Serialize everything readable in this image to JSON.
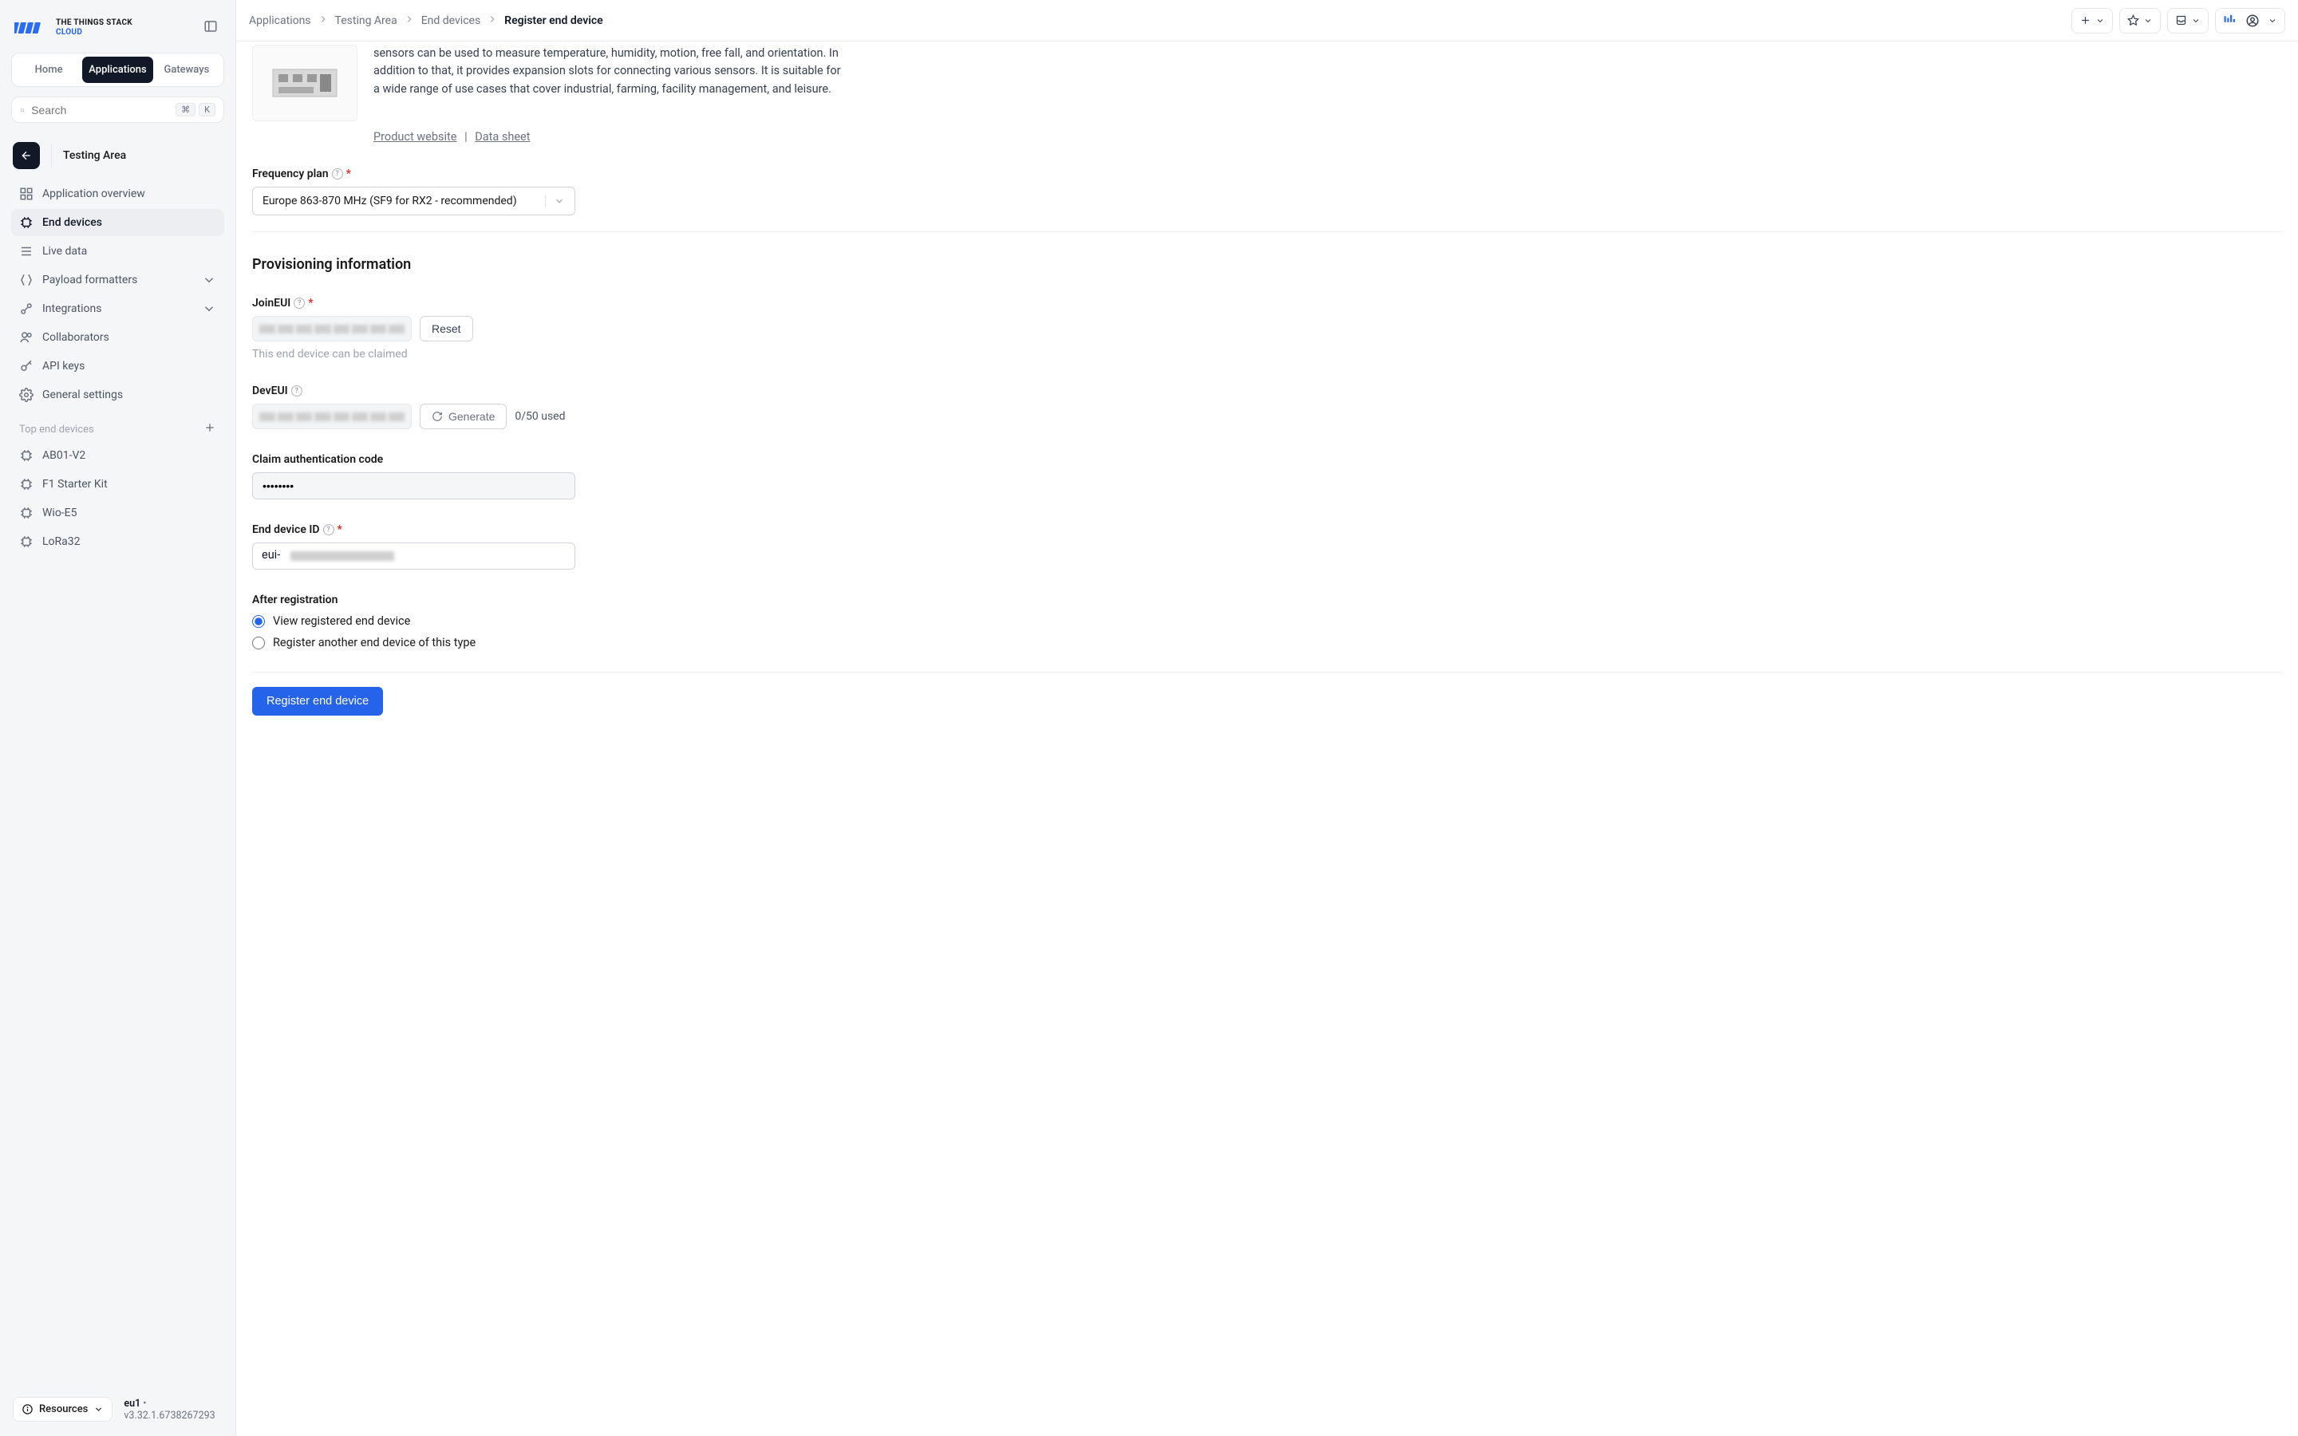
{
  "brand": {
    "line1": "THE THINGS STACK",
    "line2": "CLOUD"
  },
  "tabs": {
    "home": "Home",
    "applications": "Applications",
    "gateways": "Gateways"
  },
  "search": {
    "placeholder": "Search",
    "kbd1": "⌘",
    "kbd2": "K"
  },
  "appContext": {
    "name": "Testing Area"
  },
  "nav": {
    "overview": "Application overview",
    "endDevices": "End devices",
    "liveData": "Live data",
    "payload": "Payload formatters",
    "integrations": "Integrations",
    "collaborators": "Collaborators",
    "apiKeys": "API keys",
    "general": "General settings"
  },
  "topDevices": {
    "header": "Top end devices",
    "items": [
      "AB01-V2",
      "F1 Starter Kit",
      "Wio-E5",
      "LoRa32"
    ]
  },
  "footer": {
    "resources": "Resources",
    "cluster": "eu1",
    "version": "v3.32.1.6738267293"
  },
  "breadcrumb": {
    "c1": "Applications",
    "c2": "Testing Area",
    "c3": "End devices",
    "c4": "Register end device"
  },
  "product": {
    "descFragment": "sensors can be used to measure temperature, humidity, motion, free fall, and orientation. In addition to that, it provides expansion slots for connecting various sensors. It is suitable for a wide range of use cases that cover industrial, farming, facility management, and leisure.",
    "link1": "Product website",
    "link2": "Data sheet"
  },
  "freq": {
    "label": "Frequency plan",
    "value": "Europe 863-870 MHz (SF9 for RX2 - recommended)"
  },
  "prov": {
    "title": "Provisioning information",
    "joinEui": {
      "label": "JoinEUI",
      "reset": "Reset",
      "hint": "This end device can be claimed"
    },
    "devEui": {
      "label": "DevEUI",
      "generate": "Generate",
      "counter": "0/50 used"
    },
    "claim": {
      "label": "Claim authentication code",
      "value": "••••••••"
    },
    "deviceId": {
      "label": "End device ID",
      "prefix": "eui-"
    },
    "after": {
      "label": "After registration",
      "opt1": "View registered end device",
      "opt2": "Register another end device of this type"
    },
    "submit": "Register end device"
  }
}
